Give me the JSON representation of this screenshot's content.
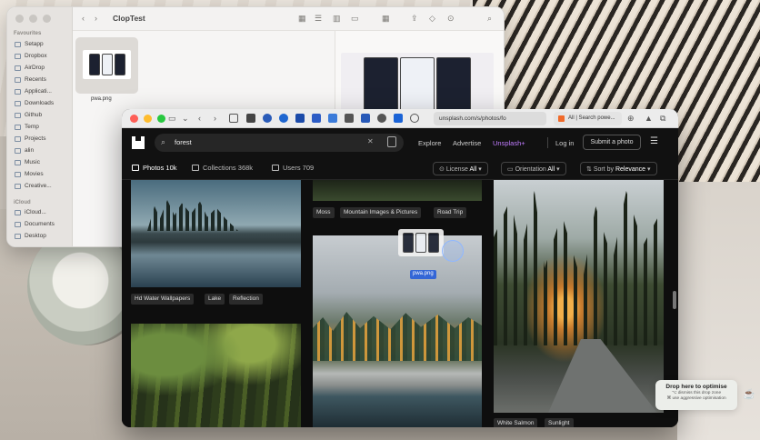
{
  "finder": {
    "title": "ClopTest",
    "sidebar_heading_favourites": "Favourites",
    "sidebar_favourites": [
      "Setapp",
      "Dropbox",
      "AirDrop",
      "Recents",
      "Applicati...",
      "Downloads",
      "Github",
      "Temp",
      "Projects",
      "alin",
      "Music",
      "Movies",
      "Creative..."
    ],
    "sidebar_heading_icloud": "iCloud",
    "sidebar_icloud": [
      "iCloud...",
      "Documents",
      "Desktop"
    ],
    "file_name": "pwa.png"
  },
  "safari": {
    "url": "unsplash.com/s/photos/fo",
    "second_tab": "All | Search powe..."
  },
  "unsplash": {
    "search_value": "forest",
    "nav": {
      "explore": "Explore",
      "advertise": "Advertise",
      "plus": "Unsplash+",
      "login": "Log in",
      "submit": "Submit a photo"
    },
    "tabs": {
      "photos": "Photos 10k",
      "collections": "Collections 368k",
      "users": "Users 709"
    },
    "filters": {
      "license_label": "License",
      "license_value": "All",
      "orientation_label": "Orientation",
      "orientation_value": "All",
      "sort_label": "Sort by",
      "sort_value": "Relevance"
    },
    "tags_col1": [
      "Hd Water Wallpapers",
      "Lake",
      "Reflection"
    ],
    "tags_col2": [
      "Moss",
      "Mountain Images & Pictures",
      "Road Trip"
    ],
    "tags_col3": [
      "White Salmon",
      "Sunlight"
    ]
  },
  "drag": {
    "file_label": "pwa.png"
  },
  "dropzone": {
    "title": "Drop here to optimise",
    "line1": "⌥ dismiss this drop zone",
    "line2": "⌘ use aggressive optimisation"
  },
  "colors": {
    "unsplash_plus": "#c07cff",
    "drag_label": "#3466d6",
    "close": "#fe5f57",
    "minimize": "#febc2e",
    "zoom": "#28c840"
  }
}
